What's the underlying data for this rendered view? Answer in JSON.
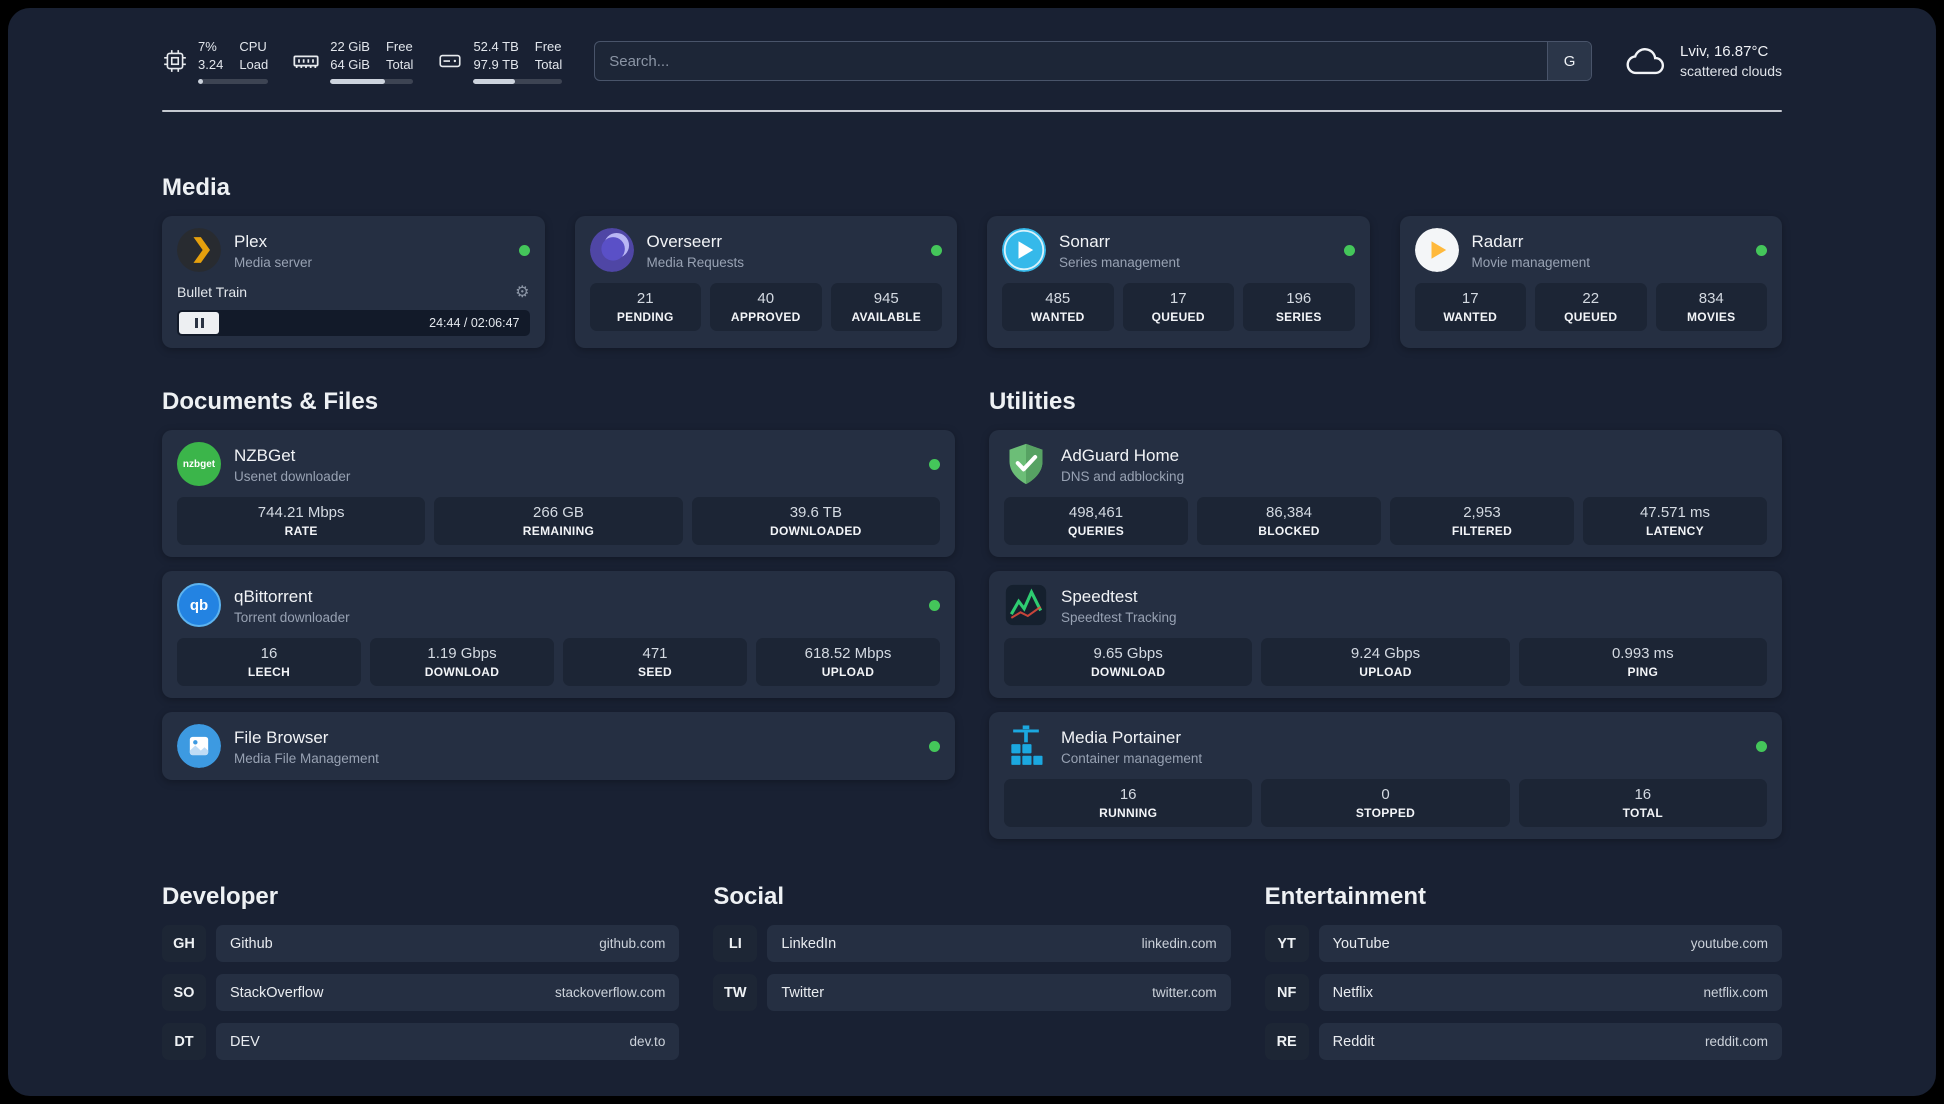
{
  "topbar": {
    "cpu": {
      "value": "7%",
      "sub": "3.24",
      "label1": "CPU",
      "label2": "Load",
      "bar_style": "width:7%"
    },
    "ram": {
      "value": "22 GiB",
      "sub": "64 GiB",
      "label1": "Free",
      "label2": "Total",
      "bar_style": "width:66%"
    },
    "disk": {
      "value": "52.4 TB",
      "sub": "97.9 TB",
      "label1": "Free",
      "label2": "Total",
      "bar_style": "width:47%"
    },
    "search": {
      "placeholder": "Search...",
      "button": "G"
    },
    "weather": {
      "location": "Lviv, 16.87°C",
      "condition": "scattered clouds"
    }
  },
  "media": {
    "title": "Media",
    "plex": {
      "name": "Plex",
      "subtitle": "Media server",
      "now_playing": "Bullet Train",
      "time": "24:44 / 02:06:47"
    },
    "overseerr": {
      "name": "Overseerr",
      "subtitle": "Media Requests",
      "stats": [
        {
          "value": "21",
          "label": "PENDING"
        },
        {
          "value": "40",
          "label": "APPROVED"
        },
        {
          "value": "945",
          "label": "AVAILABLE"
        }
      ]
    },
    "sonarr": {
      "name": "Sonarr",
      "subtitle": "Series management",
      "stats": [
        {
          "value": "485",
          "label": "WANTED"
        },
        {
          "value": "17",
          "label": "QUEUED"
        },
        {
          "value": "196",
          "label": "SERIES"
        }
      ]
    },
    "radarr": {
      "name": "Radarr",
      "subtitle": "Movie management",
      "stats": [
        {
          "value": "17",
          "label": "WANTED"
        },
        {
          "value": "22",
          "label": "QUEUED"
        },
        {
          "value": "834",
          "label": "MOVIES"
        }
      ]
    }
  },
  "documents": {
    "title": "Documents & Files",
    "nzbget": {
      "name": "NZBGet",
      "subtitle": "Usenet downloader",
      "icon_text": "nzbget",
      "stats": [
        {
          "value": "744.21 Mbps",
          "label": "RATE"
        },
        {
          "value": "266 GB",
          "label": "REMAINING"
        },
        {
          "value": "39.6 TB",
          "label": "DOWNLOADED"
        }
      ]
    },
    "qbittorrent": {
      "name": "qBittorrent",
      "subtitle": "Torrent downloader",
      "icon_text": "qb",
      "stats": [
        {
          "value": "16",
          "label": "LEECH"
        },
        {
          "value": "1.19 Gbps",
          "label": "DOWNLOAD"
        },
        {
          "value": "471",
          "label": "SEED"
        },
        {
          "value": "618.52 Mbps",
          "label": "UPLOAD"
        }
      ]
    },
    "filebrowser": {
      "name": "File Browser",
      "subtitle": "Media File Management"
    }
  },
  "utilities": {
    "title": "Utilities",
    "adguard": {
      "name": "AdGuard Home",
      "subtitle": "DNS and adblocking",
      "stats": [
        {
          "value": "498,461",
          "label": "QUERIES"
        },
        {
          "value": "86,384",
          "label": "BLOCKED"
        },
        {
          "value": "2,953",
          "label": "FILTERED"
        },
        {
          "value": "47.571 ms",
          "label": "LATENCY"
        }
      ]
    },
    "speedtest": {
      "name": "Speedtest",
      "subtitle": "Speedtest Tracking",
      "stats": [
        {
          "value": "9.65 Gbps",
          "label": "DOWNLOAD"
        },
        {
          "value": "9.24 Gbps",
          "label": "UPLOAD"
        },
        {
          "value": "0.993 ms",
          "label": "PING"
        }
      ]
    },
    "portainer": {
      "name": "Media Portainer",
      "subtitle": "Container management",
      "stats": [
        {
          "value": "16",
          "label": "RUNNING"
        },
        {
          "value": "0",
          "label": "STOPPED"
        },
        {
          "value": "16",
          "label": "TOTAL"
        }
      ]
    }
  },
  "bookmarks": {
    "developer": {
      "title": "Developer",
      "items": [
        {
          "abbr": "GH",
          "name": "Github",
          "url": "github.com"
        },
        {
          "abbr": "SO",
          "name": "StackOverflow",
          "url": "stackoverflow.com"
        },
        {
          "abbr": "DT",
          "name": "DEV",
          "url": "dev.to"
        }
      ]
    },
    "social": {
      "title": "Social",
      "items": [
        {
          "abbr": "LI",
          "name": "LinkedIn",
          "url": "linkedin.com"
        },
        {
          "abbr": "TW",
          "name": "Twitter",
          "url": "twitter.com"
        }
      ]
    },
    "entertainment": {
      "title": "Entertainment",
      "items": [
        {
          "abbr": "YT",
          "name": "YouTube",
          "url": "youtube.com"
        },
        {
          "abbr": "NF",
          "name": "Netflix",
          "url": "netflix.com"
        },
        {
          "abbr": "RE",
          "name": "Reddit",
          "url": "reddit.com"
        }
      ]
    }
  },
  "colors": {
    "status_online": "#44c65a",
    "accent_plex": "#e5a00d",
    "background": "#192133",
    "card": "#252f42"
  }
}
